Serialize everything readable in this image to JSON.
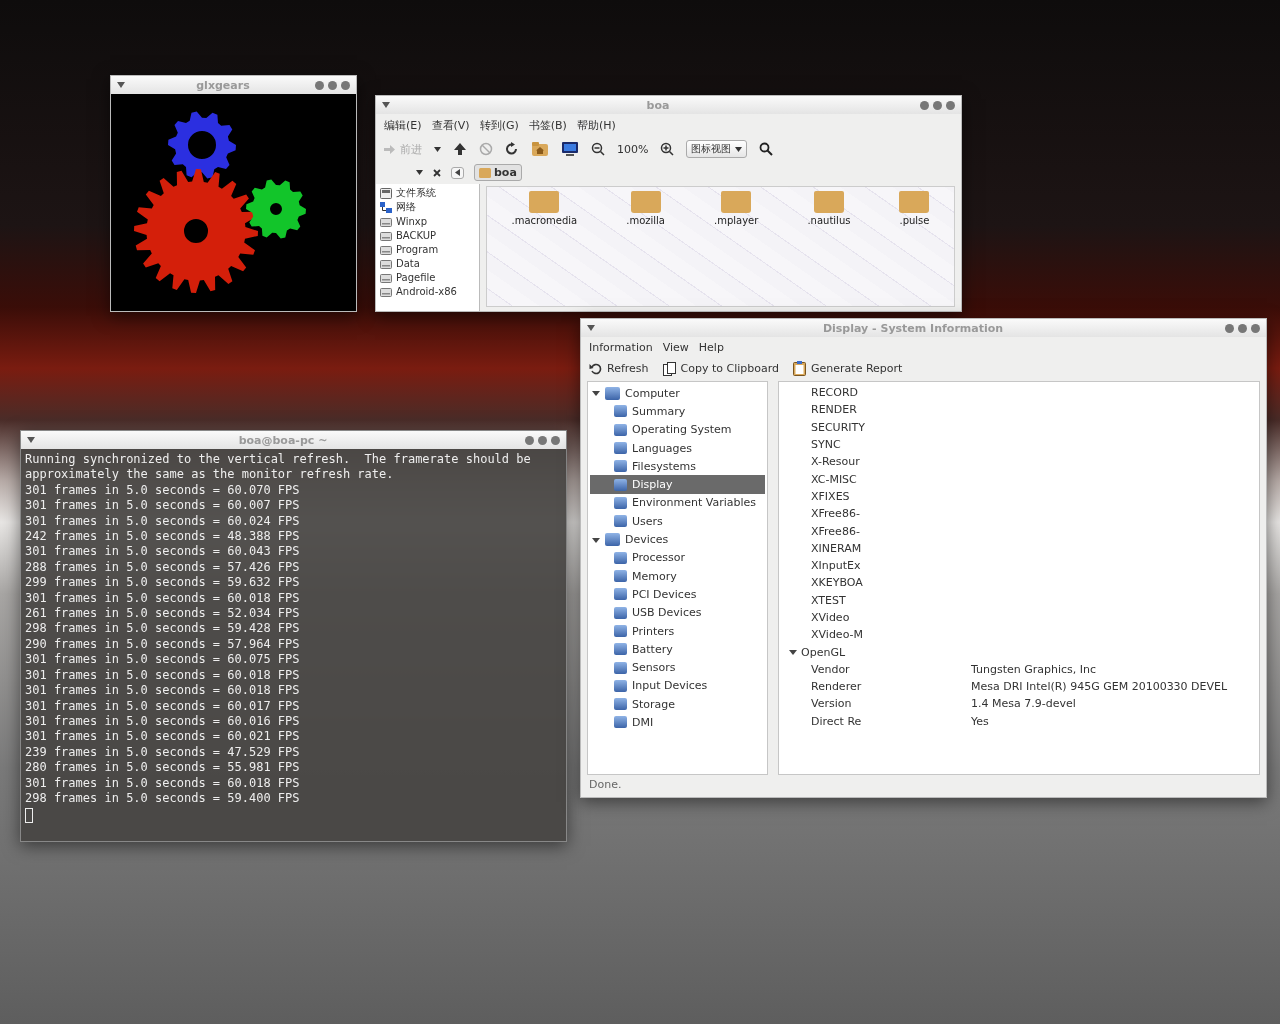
{
  "glxgears": {
    "title": "glxgears"
  },
  "file_manager": {
    "title": "boa",
    "menu": [
      "编辑(E)",
      "查看(V)",
      "转到(G)",
      "书签(B)",
      "帮助(H)"
    ],
    "toolbar": {
      "forward": "前进",
      "zoom": "100%",
      "view": "图标视图"
    },
    "path": "boa",
    "sidebar": [
      {
        "label": "文件系统",
        "kind": "filesystem"
      },
      {
        "label": "网络",
        "kind": "network"
      },
      {
        "label": "Winxp",
        "kind": "drive"
      },
      {
        "label": "BACKUP",
        "kind": "drive"
      },
      {
        "label": "Program",
        "kind": "drive"
      },
      {
        "label": "Data",
        "kind": "drive"
      },
      {
        "label": "Pagefile",
        "kind": "drive"
      },
      {
        "label": "Android-x86",
        "kind": "drive"
      }
    ],
    "folders": [
      ".macromedia",
      ".mozilla",
      ".mplayer",
      ".nautilus",
      ".pulse"
    ]
  },
  "terminal": {
    "title": "boa@boa-pc ~",
    "lines": [
      "Running synchronized to the vertical refresh.  The framerate should be",
      "approximately the same as the monitor refresh rate.",
      "301 frames in 5.0 seconds = 60.070 FPS",
      "301 frames in 5.0 seconds = 60.007 FPS",
      "301 frames in 5.0 seconds = 60.024 FPS",
      "242 frames in 5.0 seconds = 48.388 FPS",
      "301 frames in 5.0 seconds = 60.043 FPS",
      "288 frames in 5.0 seconds = 57.426 FPS",
      "299 frames in 5.0 seconds = 59.632 FPS",
      "301 frames in 5.0 seconds = 60.018 FPS",
      "261 frames in 5.0 seconds = 52.034 FPS",
      "298 frames in 5.0 seconds = 59.428 FPS",
      "290 frames in 5.0 seconds = 57.964 FPS",
      "301 frames in 5.0 seconds = 60.075 FPS",
      "301 frames in 5.0 seconds = 60.018 FPS",
      "301 frames in 5.0 seconds = 60.018 FPS",
      "301 frames in 5.0 seconds = 60.017 FPS",
      "301 frames in 5.0 seconds = 60.016 FPS",
      "301 frames in 5.0 seconds = 60.021 FPS",
      "239 frames in 5.0 seconds = 47.529 FPS",
      "280 frames in 5.0 seconds = 55.981 FPS",
      "301 frames in 5.0 seconds = 60.018 FPS",
      "298 frames in 5.0 seconds = 59.400 FPS"
    ]
  },
  "system_info": {
    "title": "Display - System Information",
    "menu": [
      "Information",
      "View",
      "Help"
    ],
    "toolbar": [
      {
        "label": "Refresh",
        "kind": "refresh"
      },
      {
        "label": "Copy to Clipboard",
        "kind": "copy"
      },
      {
        "label": "Generate Report",
        "kind": "report"
      }
    ],
    "tree": [
      {
        "label": "Computer",
        "expanded": true,
        "selected": false,
        "children": [
          {
            "label": "Summary",
            "selected": false
          },
          {
            "label": "Operating System",
            "selected": false
          },
          {
            "label": "Languages",
            "selected": false
          },
          {
            "label": "Filesystems",
            "selected": false
          },
          {
            "label": "Display",
            "selected": true
          },
          {
            "label": "Environment Variables",
            "selected": false
          },
          {
            "label": "Users",
            "selected": false
          }
        ]
      },
      {
        "label": "Devices",
        "expanded": true,
        "selected": false,
        "children": [
          {
            "label": "Processor",
            "selected": false
          },
          {
            "label": "Memory",
            "selected": false
          },
          {
            "label": "PCI Devices",
            "selected": false
          },
          {
            "label": "USB Devices",
            "selected": false
          },
          {
            "label": "Printers",
            "selected": false
          },
          {
            "label": "Battery",
            "selected": false
          },
          {
            "label": "Sensors",
            "selected": false
          },
          {
            "label": "Input Devices",
            "selected": false
          },
          {
            "label": "Storage",
            "selected": false
          },
          {
            "label": "DMI",
            "selected": false
          }
        ]
      }
    ],
    "extensions": [
      "RECORD",
      "RENDER",
      "SECURITY",
      "SYNC",
      "X-Resour",
      "XC-MISC",
      "XFIXES",
      "XFree86-",
      "XFree86-",
      "XINERAM",
      "XInputEx",
      "XKEYBOA",
      "XTEST",
      "XVideo",
      "XVideo-M"
    ],
    "opengl": {
      "label": "OpenGL",
      "expanded": true,
      "rows": [
        {
          "label": "Vendor",
          "value": "Tungsten Graphics, Inc"
        },
        {
          "label": "Renderer",
          "value": "Mesa DRI Intel(R) 945G GEM 20100330 DEVEL"
        },
        {
          "label": "Version",
          "value": "1.4 Mesa 7.9-devel"
        },
        {
          "label": "Direct Re",
          "value": "Yes"
        }
      ]
    },
    "status": "Done."
  }
}
